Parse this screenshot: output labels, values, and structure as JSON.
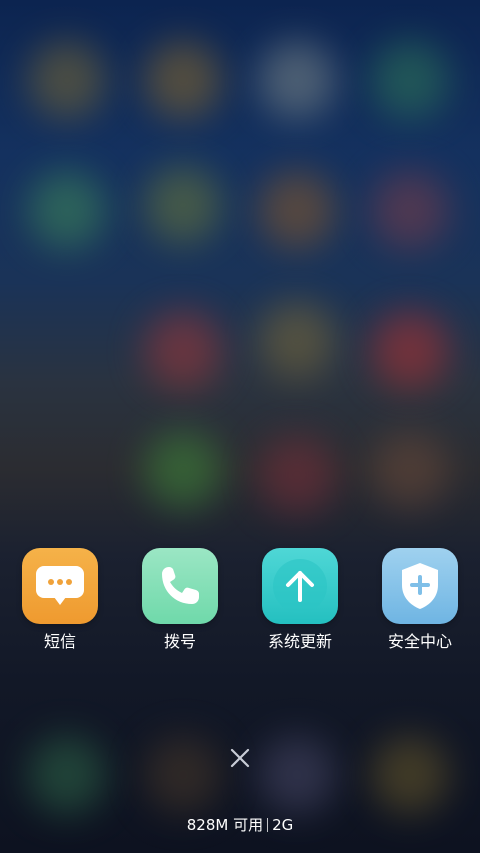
{
  "apps": [
    {
      "label": "短信",
      "icon": "message-icon",
      "color_top": "#f5b249",
      "color_bottom": "#ef9a2f"
    },
    {
      "label": "拨号",
      "icon": "phone-icon",
      "color_top": "#9be6c4",
      "color_bottom": "#6fd9aa"
    },
    {
      "label": "系统更新",
      "icon": "system-update-icon",
      "color_top": "#4fd7d6",
      "color_bottom": "#24c0c0"
    },
    {
      "label": "安全中心",
      "icon": "security-center-icon",
      "color_top": "#9fd1ef",
      "color_bottom": "#6fb5e3"
    }
  ],
  "close_icon": "close-icon",
  "memory": {
    "available": "828M 可用",
    "total": "2G"
  },
  "background_blobs": [
    "#7b6a34",
    "#8a6a2c",
    "#7f8a8a",
    "#2f7a58",
    "#3f8b5a",
    "#6b7a3a",
    "#8a5a2a",
    "#7d3e4a",
    "#a0383a",
    "#7a6a3a",
    "#b23232",
    "#3f8a3a",
    "#7a2f3a",
    "#6a4a3a",
    "#2f6a4a",
    "#4a3a2a",
    "#4a4a6a",
    "#6a5a2a"
  ]
}
